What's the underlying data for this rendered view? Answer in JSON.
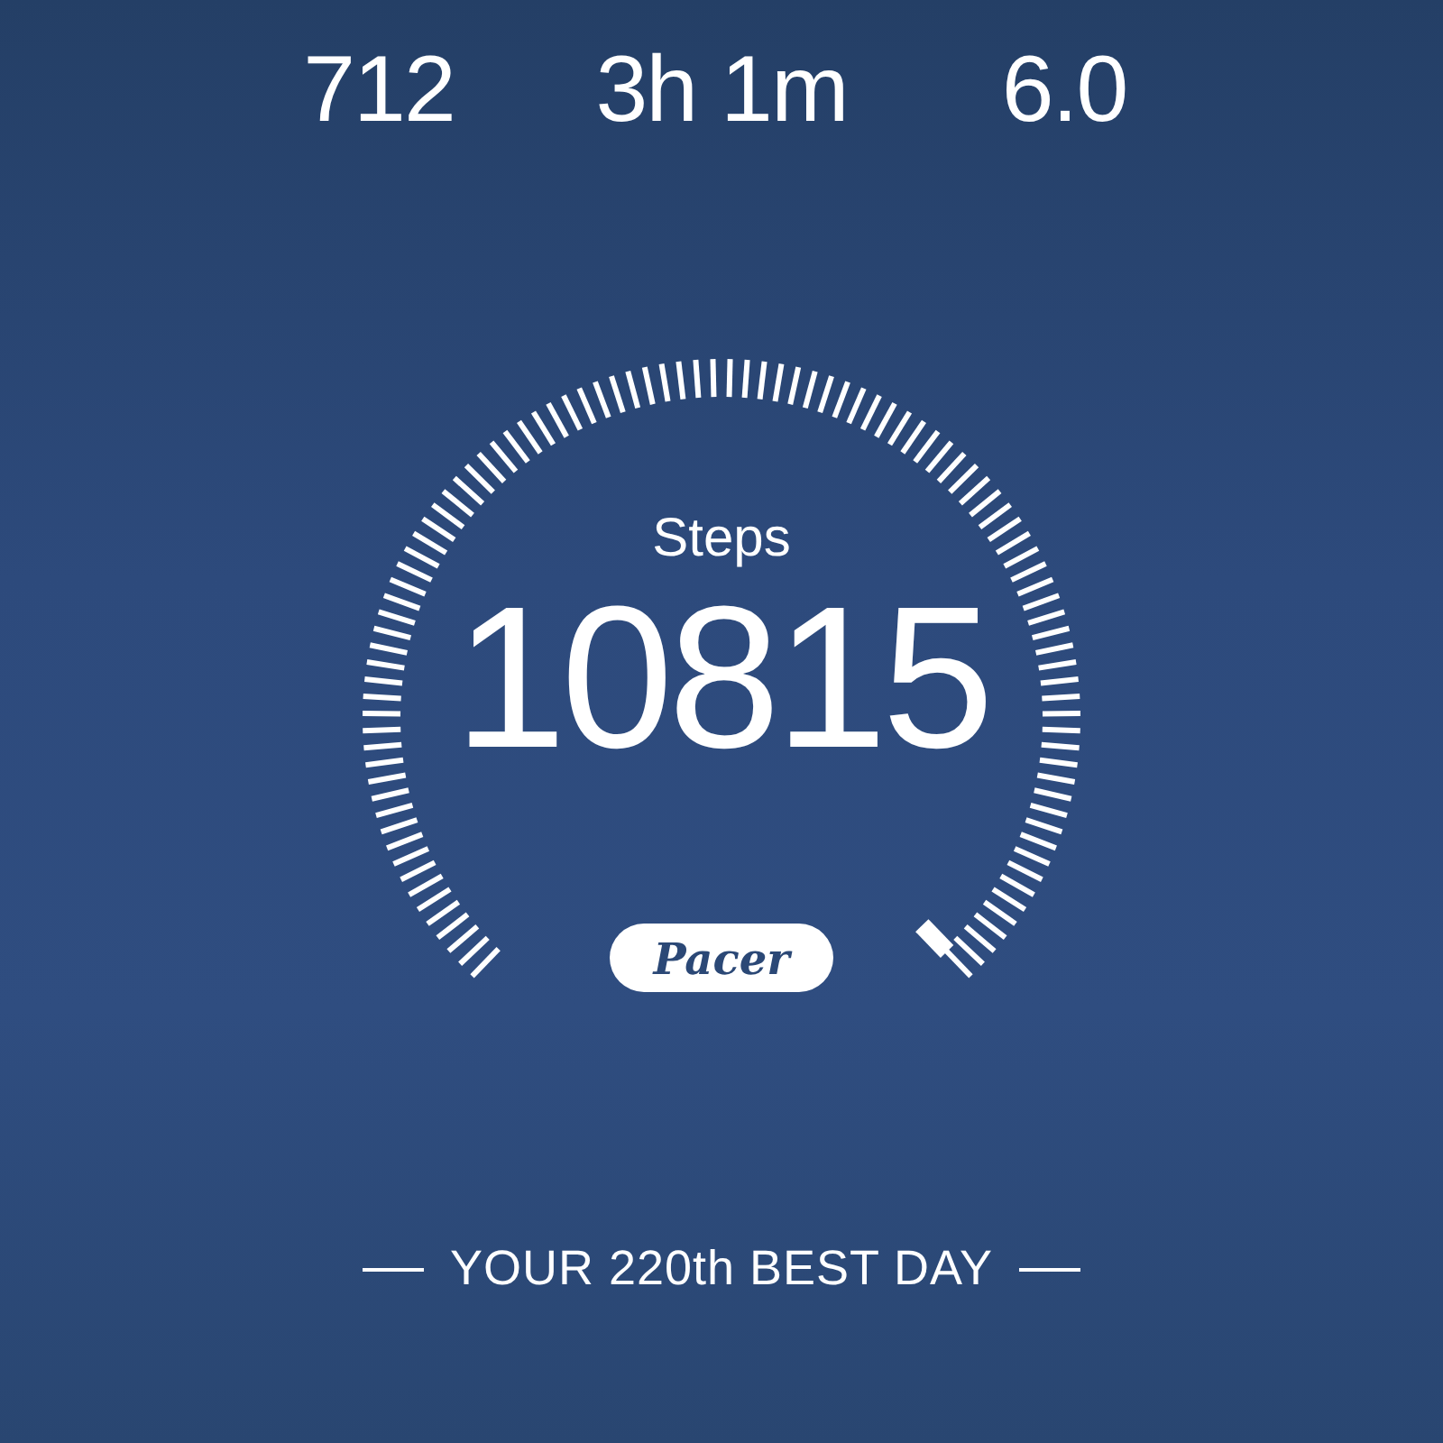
{
  "stats": [
    {
      "value": "712"
    },
    {
      "value": "3h 1m"
    },
    {
      "value": "6.0"
    }
  ],
  "steps": {
    "label": "Steps",
    "value": "10815"
  },
  "logo": "Pacer",
  "rank": "YOUR 220th BEST DAY"
}
